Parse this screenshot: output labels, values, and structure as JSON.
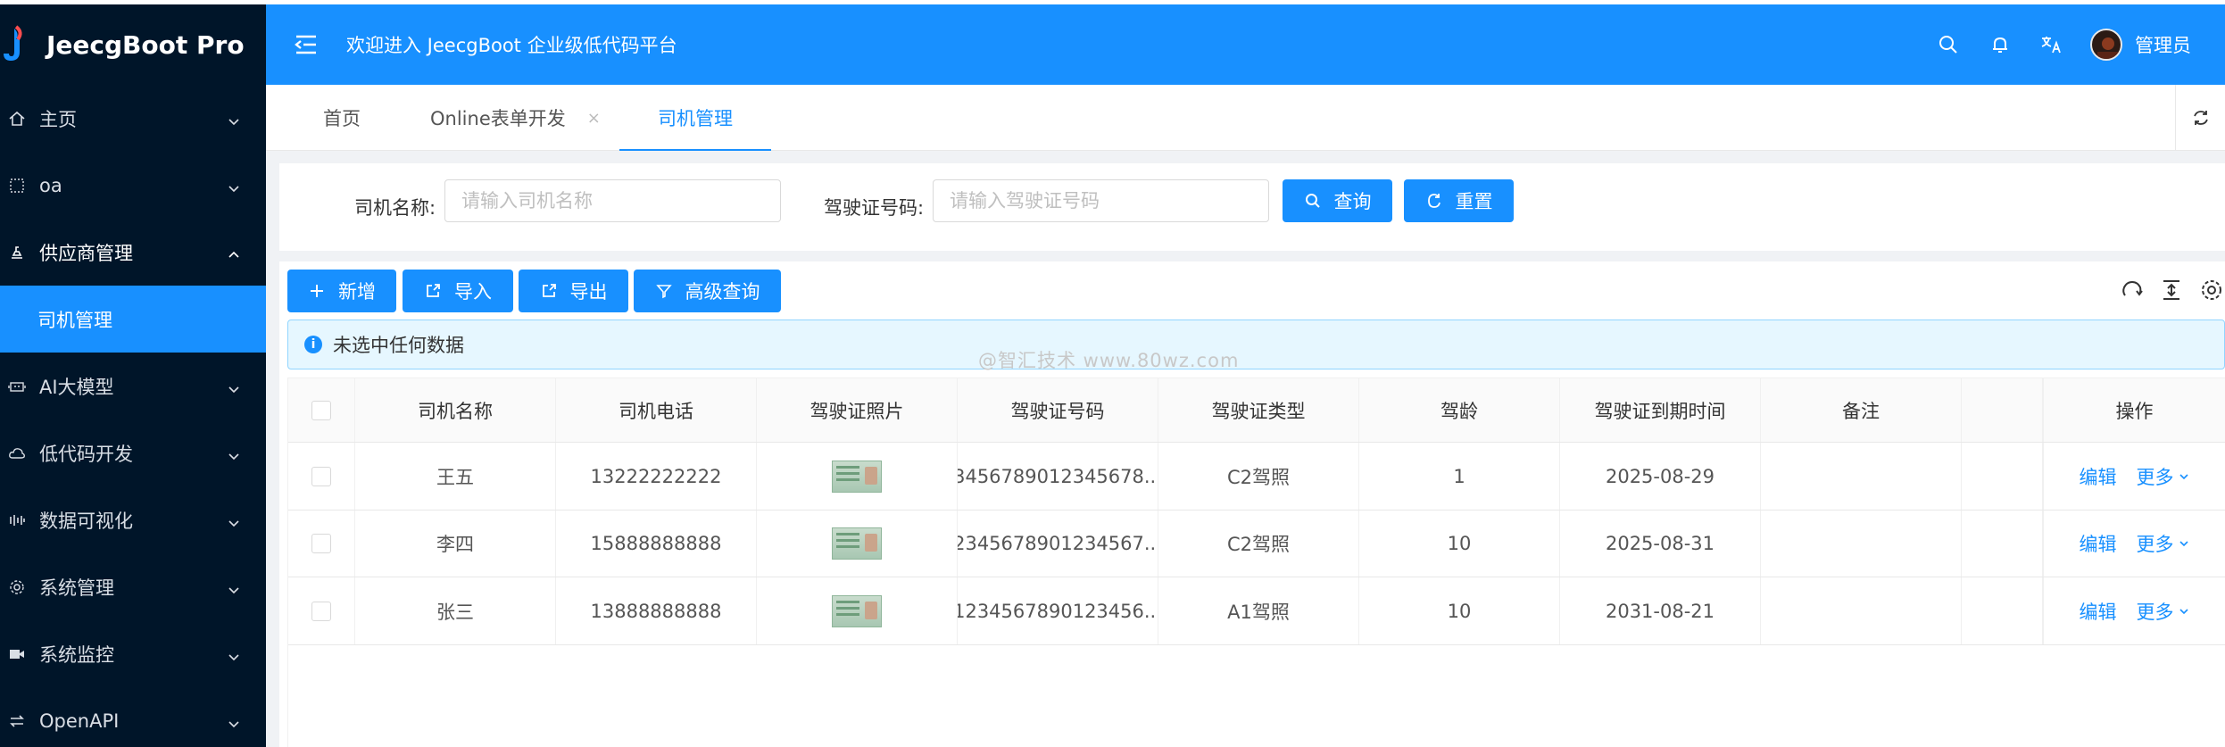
{
  "app": {
    "name": "JeecgBoot Pro"
  },
  "header": {
    "welcome": "欢迎进入 JeecgBoot 企业级低代码平台",
    "user": "管理员"
  },
  "sidebar": {
    "items": [
      {
        "label": "主页",
        "icon": "home-icon"
      },
      {
        "label": "oa",
        "icon": "grid-icon"
      },
      {
        "label": "供应商管理",
        "icon": "stamp-icon",
        "open": true,
        "children": [
          {
            "label": "司机管理"
          }
        ]
      },
      {
        "label": "AI大模型",
        "icon": "robot-icon"
      },
      {
        "label": "低代码开发",
        "icon": "cloud-icon"
      },
      {
        "label": "数据可视化",
        "icon": "chart-bars-icon"
      },
      {
        "label": "系统管理",
        "icon": "gear-icon"
      },
      {
        "label": "系统监控",
        "icon": "camera-icon"
      },
      {
        "label": "OpenAPI",
        "icon": "swap-icon"
      }
    ]
  },
  "tabs": [
    {
      "label": "首页"
    },
    {
      "label": "Online表单开发",
      "close": "×"
    },
    {
      "label": "司机管理",
      "active": true
    }
  ],
  "search": {
    "name_label": "司机名称:",
    "name_placeholder": "请输入司机名称",
    "license_label": "驾驶证号码:",
    "license_placeholder": "请输入驾驶证号码",
    "query_label": "查询",
    "reset_label": "重置"
  },
  "toolbar": {
    "add": "新增",
    "import": "导入",
    "export": "导出",
    "advanced": "高级查询"
  },
  "alert": {
    "text": "未选中任何数据"
  },
  "watermark": "@智汇技术 www.80wz.com",
  "table": {
    "columns": [
      "司机名称",
      "司机电话",
      "驾驶证照片",
      "驾驶证号码",
      "驾驶证类型",
      "驾龄",
      "驾驶证到期时间",
      "备注",
      "操作"
    ],
    "rows": [
      {
        "name": "王五",
        "phone": "13222222222",
        "license": "3456789012345678...",
        "type": "C2驾照",
        "years": "1",
        "expire": "2025-08-29",
        "remark": ""
      },
      {
        "name": "李四",
        "phone": "15888888888",
        "license": "2345678901234567...",
        "type": "C2驾照",
        "years": "10",
        "expire": "2025-08-31",
        "remark": ""
      },
      {
        "name": "张三",
        "phone": "13888888888",
        "license": "1234567890123456...",
        "type": "A1驾照",
        "years": "10",
        "expire": "2031-08-21",
        "remark": ""
      }
    ],
    "edit_label": "编辑",
    "more_label": "更多"
  },
  "colors": {
    "primary": "#1890ff",
    "sidebar": "#001529",
    "alert_bg": "#e6f7ff"
  }
}
